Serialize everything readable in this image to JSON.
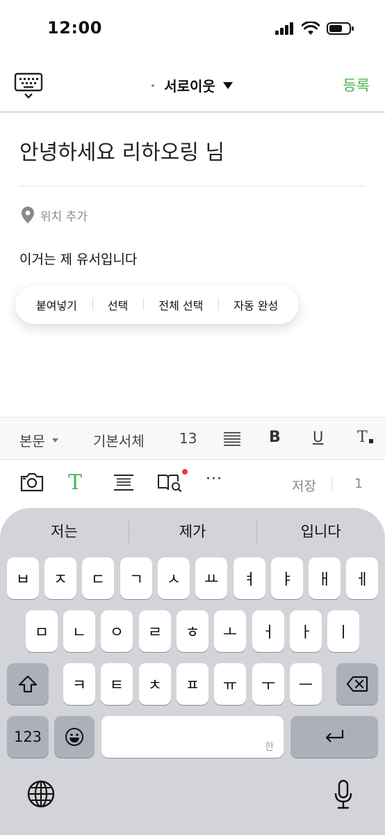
{
  "status_bar": {
    "time": "12:00"
  },
  "header": {
    "audience": "서로이웃",
    "submit_label": "등록"
  },
  "post": {
    "title": "안녕하세요 리하오링 님",
    "location_label": "위치 추가",
    "body": "이거는 제 유서입니다"
  },
  "context_menu": {
    "items": [
      "붙여넣기",
      "선택",
      "전체 선택",
      "자동 완성"
    ]
  },
  "format_toolbar": {
    "paragraph_style": "본문",
    "font": "기본서체",
    "font_size": "13",
    "bold": "B",
    "underline": "U",
    "clear_format": "T"
  },
  "insert_toolbar": {
    "text_label": "T",
    "more": "···",
    "save_label": "저장",
    "save_count": "1"
  },
  "keyboard": {
    "suggestions": [
      "저는",
      "제가",
      "입니다"
    ],
    "row1": [
      "ㅂ",
      "ㅈ",
      "ㄷ",
      "ㄱ",
      "ㅅ",
      "ㅛ",
      "ㅕ",
      "ㅑ",
      "ㅐ",
      "ㅔ"
    ],
    "row2": [
      "ㅁ",
      "ㄴ",
      "ㅇ",
      "ㄹ",
      "ㅎ",
      "ㅗ",
      "ㅓ",
      "ㅏ",
      "ㅣ"
    ],
    "row3": [
      "ㅋ",
      "ㅌ",
      "ㅊ",
      "ㅍ",
      "ㅠ",
      "ㅜ",
      "ㅡ"
    ],
    "numbers_label": "123",
    "space_hint": "한"
  },
  "colors": {
    "accent_green": "#4ab34a",
    "badge_red": "#ee3a3a",
    "keyboard_bg": "#d3d4d9"
  }
}
